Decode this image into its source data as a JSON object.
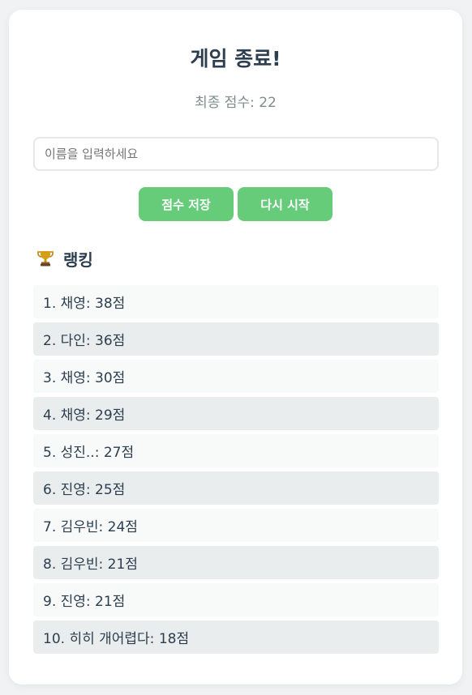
{
  "title": "게임 종료!",
  "final_score": "최종 점수: 22",
  "name_input": {
    "placeholder": "이름을 입력하세요",
    "value": ""
  },
  "buttons": {
    "save": "점수 저장",
    "restart": "다시 시작"
  },
  "ranking": {
    "title": "랭킹",
    "icon": "trophy-icon",
    "items": [
      "1. 채영: 38점",
      "2. 다인: 36점",
      "3. 채영: 30점",
      "4. 채영: 29점",
      "5. 성진..: 27점",
      "6. 진영: 25점",
      "7. 김우빈: 24점",
      "8. 김우빈: 21점",
      "9. 진영: 21점",
      "10. 히히 개어렵다: 18점"
    ]
  },
  "colors": {
    "button": "#66cc7a",
    "title": "#2c3e50",
    "subtitle": "#7f8c8d",
    "row_odd": "#f8f9f9",
    "row_even": "#eaeded"
  }
}
